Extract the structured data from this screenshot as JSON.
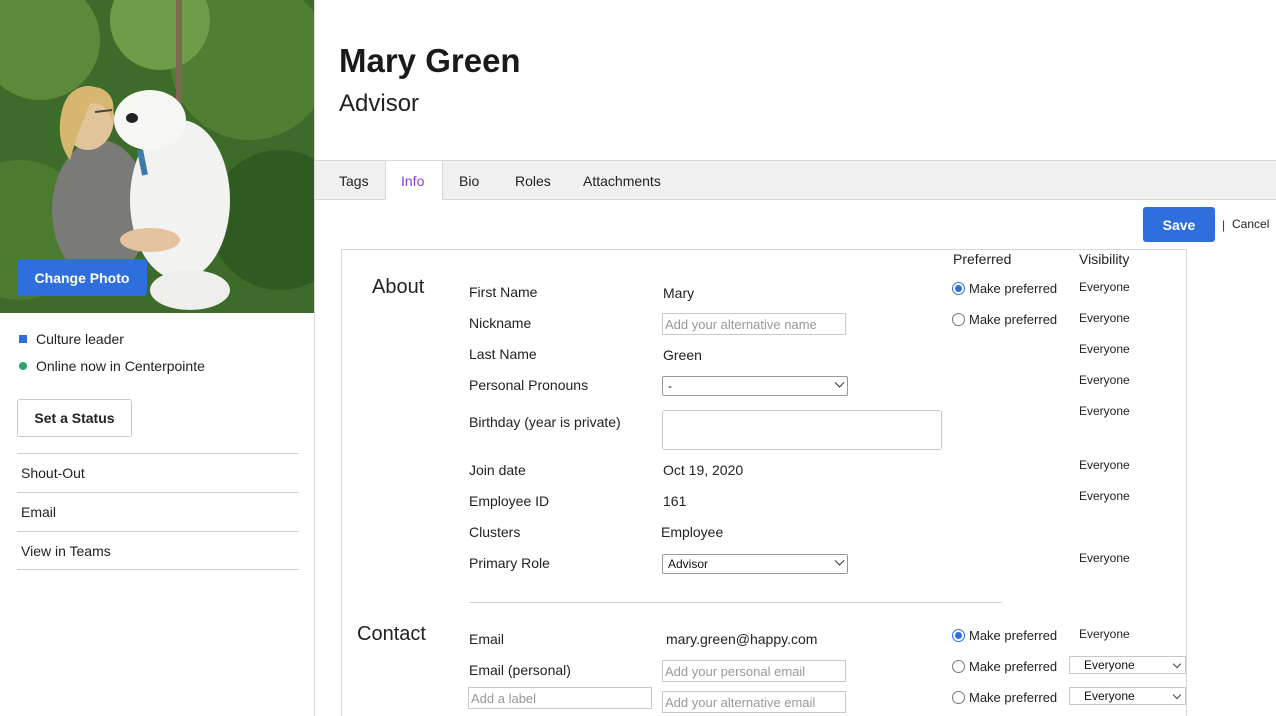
{
  "profile": {
    "name": "Mary Green",
    "title": "Advisor",
    "change_photo_label": "Change Photo",
    "badge_label": "Culture leader",
    "presence_label": "Online now in Centerpointe",
    "set_status_label": "Set a Status",
    "side_links": [
      "Shout-Out",
      "Email",
      "View in Teams"
    ],
    "colors": {
      "accent": "#2f6fdd",
      "presence": "#2fa36b",
      "active_tab": "#8a3fd6"
    }
  },
  "tabs": [
    {
      "label": "Tags",
      "active": false
    },
    {
      "label": "Info",
      "active": true
    },
    {
      "label": "Bio",
      "active": false
    },
    {
      "label": "Roles",
      "active": false
    },
    {
      "label": "Attachments",
      "active": false
    }
  ],
  "actions": {
    "save_label": "Save",
    "separator": "|",
    "cancel_label": "Cancel"
  },
  "columns": {
    "preferred": "Preferred",
    "visibility": "Visibility"
  },
  "about": {
    "section_title": "About",
    "first_name": {
      "label": "First Name",
      "value": "Mary",
      "preferred_label": "Make preferred",
      "visibility": "Everyone"
    },
    "nickname": {
      "label": "Nickname",
      "placeholder": "Add your alternative name",
      "preferred_label": "Make preferred",
      "visibility": "Everyone"
    },
    "last_name": {
      "label": "Last Name",
      "value": "Green",
      "visibility": "Everyone"
    },
    "pronouns": {
      "label": "Personal Pronouns",
      "selected": "-",
      "visibility": "Everyone"
    },
    "birthday": {
      "label": "Birthday (year is private)",
      "visibility": "Everyone"
    },
    "join_date": {
      "label": "Join date",
      "value": "Oct 19, 2020",
      "visibility": "Everyone"
    },
    "employee_id": {
      "label": "Employee ID",
      "value": "161",
      "visibility": "Everyone"
    },
    "clusters": {
      "label": "Clusters",
      "value": "Employee"
    },
    "primary_role": {
      "label": "Primary Role",
      "selected": "Advisor",
      "visibility": "Everyone"
    }
  },
  "contact": {
    "section_title": "Contact",
    "email": {
      "label": "Email",
      "value": "mary.green@happy.com",
      "preferred_label": "Make preferred",
      "visibility": "Everyone"
    },
    "email_personal": {
      "label": "Email (personal)",
      "placeholder": "Add your personal email",
      "preferred_label": "Make preferred",
      "visibility": "Everyone"
    },
    "email_alt": {
      "label_placeholder": "Add a label",
      "placeholder": "Add your alternative email",
      "preferred_label": "Make preferred",
      "visibility": "Everyone"
    }
  }
}
